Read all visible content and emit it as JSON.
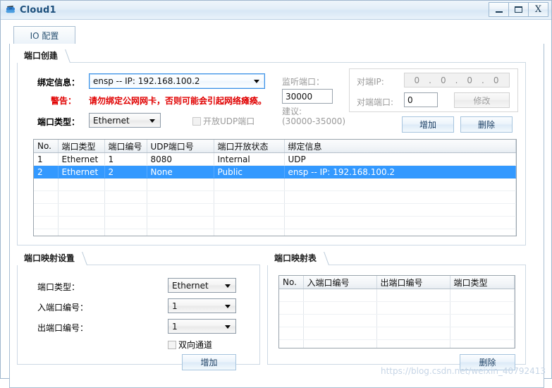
{
  "window": {
    "title": "Cloud1",
    "icon": "cloud-icon",
    "buttons": {
      "minimize": "minimize-icon",
      "maximize": "maximize-icon",
      "close": "X"
    }
  },
  "tabs": [
    {
      "label": "IO 配置",
      "selected": true
    }
  ],
  "port_create": {
    "title": "端口创建",
    "bind_info_label": "绑定信息：",
    "bind_info_value": "ensp -- IP: 192.168.100.2",
    "warning_label": "警告：",
    "warning_text": "请勿绑定公网网卡，否则可能会引起网络瘫痪。",
    "port_type_label": "端口类型：",
    "port_type_value": "Ethernet",
    "udp_checkbox_label": "开放UDP端口",
    "udp_checkbox_checked": false,
    "listen_port_label": "监听端口：",
    "listen_port_value": "30000",
    "suggest_label": "建议:",
    "suggest_range": "(30000-35000)",
    "peer_ip_label": "对端IP:",
    "peer_ip_octets": [
      "0",
      "0",
      "0",
      "0"
    ],
    "peer_ip_separator": ".",
    "peer_port_label": "对端端口:",
    "peer_port_value": "0",
    "modify_button": "修改",
    "add_button": "增加",
    "delete_button": "删除"
  },
  "port_table": {
    "columns": [
      "No.",
      "端口类型",
      "端口编号",
      "UDP端口号",
      "端口开放状态",
      "绑定信息"
    ],
    "rows": [
      {
        "cells": [
          "1",
          "Ethernet",
          "1",
          "8080",
          "Internal",
          "UDP"
        ],
        "selected": false
      },
      {
        "cells": [
          "2",
          "Ethernet",
          "2",
          "None",
          "Public",
          "ensp -- IP: 192.168.100.2"
        ],
        "selected": true
      }
    ],
    "empty_rows": 6
  },
  "mapping_settings": {
    "title": "端口映射设置",
    "port_type_label": "端口类型：",
    "port_type_value": "Ethernet",
    "in_port_label": "入端口编号：",
    "in_port_value": "1",
    "out_port_label": "出端口编号：",
    "out_port_value": "1",
    "bidirectional_label": "双向通道",
    "bidirectional_checked": false,
    "add_button": "增加"
  },
  "mapping_table": {
    "title": "端口映射表",
    "columns": [
      "No.",
      "入端口编号",
      "出端口编号",
      "端口类型"
    ],
    "rows": [],
    "empty_rows": 6,
    "delete_button": "删除"
  },
  "watermark": "https://blog.csdn.net/weixin_40792413",
  "colors": {
    "selection": "#3399ff",
    "warning": "#e00000",
    "title": "#1c4f7c",
    "accent": "#a6c4de"
  }
}
